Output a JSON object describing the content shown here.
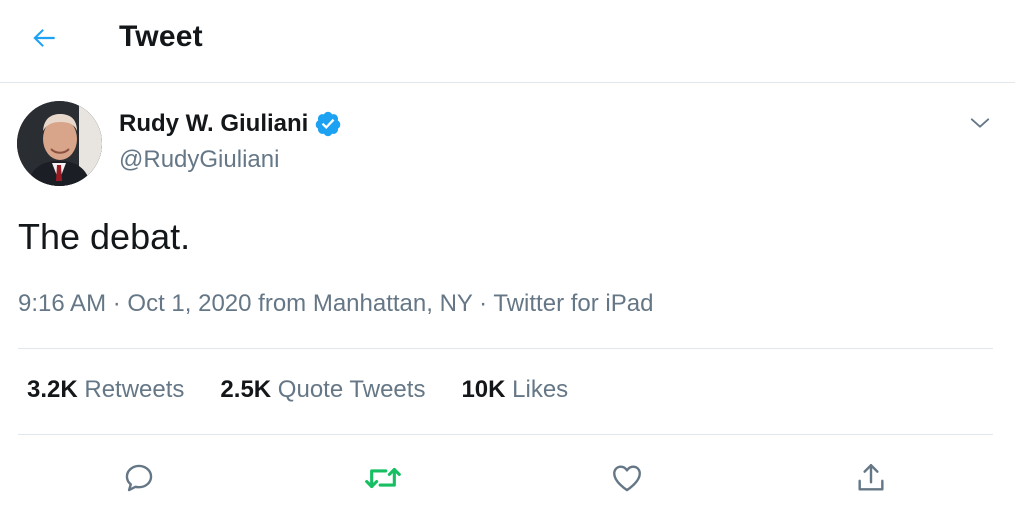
{
  "header": {
    "title": "Tweet",
    "back_icon": "arrow-left-icon",
    "accent_color": "#1da1f2"
  },
  "author": {
    "display_name": "Rudy W. Giuliani",
    "handle": "@RudyGiuliani",
    "verified_icon": "verified-badge-icon"
  },
  "tweet": {
    "text": "The debat.",
    "time": "9:16 AM",
    "date": "Oct 1, 2020",
    "from_prefix": "from",
    "location": "Manhattan, NY",
    "source": "Twitter for iPad",
    "separator": "·"
  },
  "stats": {
    "retweets_count": "3.2K",
    "retweets_label": "Retweets",
    "quotes_count": "2.5K",
    "quotes_label": "Quote Tweets",
    "likes_count": "10K",
    "likes_label": "Likes"
  },
  "actions": {
    "reply_icon": "reply-icon",
    "retweet_icon": "retweet-icon",
    "retweet_color": "#17bf63",
    "like_icon": "heart-icon",
    "share_icon": "share-icon"
  }
}
